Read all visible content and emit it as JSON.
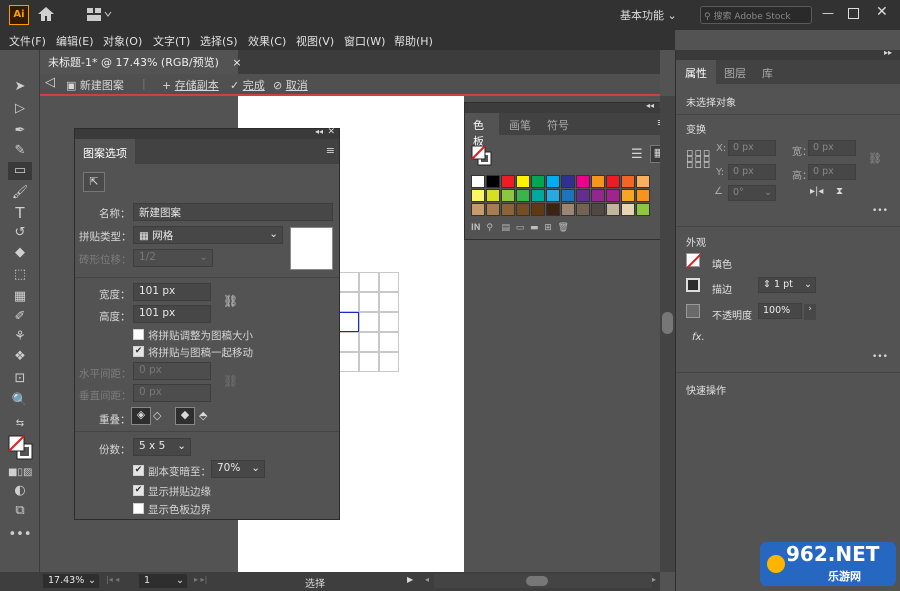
{
  "app": {
    "logo": "Ai",
    "workspace": "基本功能",
    "search_placeholder": "搜索 Adobe Stock"
  },
  "menu": [
    "文件(F)",
    "编辑(E)",
    "对象(O)",
    "文字(T)",
    "选择(S)",
    "效果(C)",
    "视图(V)",
    "窗口(W)",
    "帮助(H)"
  ],
  "document": {
    "tab_title": "未标题-1* @ 17.43% (RGB/预览)",
    "close_glyph": "×"
  },
  "pattern_bar": {
    "title": "新建图案",
    "save_copy": "存储副本",
    "done": "完成",
    "cancel": "取消"
  },
  "pattern_dialog": {
    "title": "图案选项",
    "name_label": "名称：",
    "name_value": "新建图案",
    "tile_type_label": "拼贴类型：",
    "tile_type_value": "网格",
    "brick_offset_label": "砖形位移：",
    "brick_offset_value": "1/2",
    "width_label": "宽度：",
    "width_value": "101 px",
    "height_label": "高度：",
    "height_value": "101 px",
    "resize_tile_label": "将拼贴调整为图稿大小",
    "move_tile_label": "将拼贴与图稿一起移动",
    "h_spacing_label": "水平间距：",
    "h_spacing_value": "0 px",
    "v_spacing_label": "垂直间距：",
    "v_spacing_value": "0 px",
    "overlap_label": "重叠：",
    "copies_label": "份数：",
    "copies_value": "5 x 5",
    "dim_copies_label": "副本变暗至：",
    "dim_copies_value": "70%",
    "show_tile_edge_label": "显示拼贴边缘",
    "show_swatch_bounds_label": "显示色板边界",
    "checks": {
      "resize_tile": false,
      "move_tile": true,
      "dim_copies": true,
      "show_tile_edge": true,
      "show_swatch_bounds": false
    }
  },
  "swatches_panel": {
    "tabs": [
      "色板",
      "画笔",
      "符号"
    ],
    "row1": [
      "#ffffff",
      "#000000",
      "#ee1c24",
      "#fff200",
      "#00a651",
      "#00aeef",
      "#2e3192",
      "#ec008c",
      "#f7941d",
      "#ed1c24",
      "#f26522",
      "#fbaf5d"
    ],
    "row2": [
      "#fff568",
      "#d7df23",
      "#8dc63f",
      "#39b54a",
      "#00a99d",
      "#27aae1",
      "#1c75bc",
      "#662d91",
      "#92278f",
      "#a3238e",
      "#f5a623",
      "#f7941d"
    ],
    "row3": [
      "#c69c6d",
      "#a67c52",
      "#8c6239",
      "#754c24",
      "#603913",
      "#3c2415",
      "#998675",
      "#736357",
      "#534741",
      "#c2b59b",
      "#e6d2b5",
      "#8dc63f"
    ]
  },
  "right_panel": {
    "tabs": [
      "属性",
      "图层",
      "库"
    ],
    "no_selection": "未选择对象",
    "transform_title": "变换",
    "x_label": "X:",
    "x_value": "0 px",
    "y_label": "Y:",
    "y_value": "0 px",
    "w_label": "宽：",
    "w_value": "0 px",
    "h_label": "高：",
    "h_value": "0 px",
    "angle_value": "0°",
    "appearance_title": "外观",
    "fill_label": "填色",
    "stroke_label": "描边",
    "stroke_value": "1 pt",
    "opacity_label": "不透明度",
    "opacity_value": "100%",
    "fx_label": "fx.",
    "quick_actions_title": "快速操作",
    "more": "•••"
  },
  "status": {
    "zoom": "17.43%",
    "artboard_num": "1",
    "tool": "选择"
  },
  "watermark": {
    "text": "962.NET",
    "sub": "乐游网"
  }
}
